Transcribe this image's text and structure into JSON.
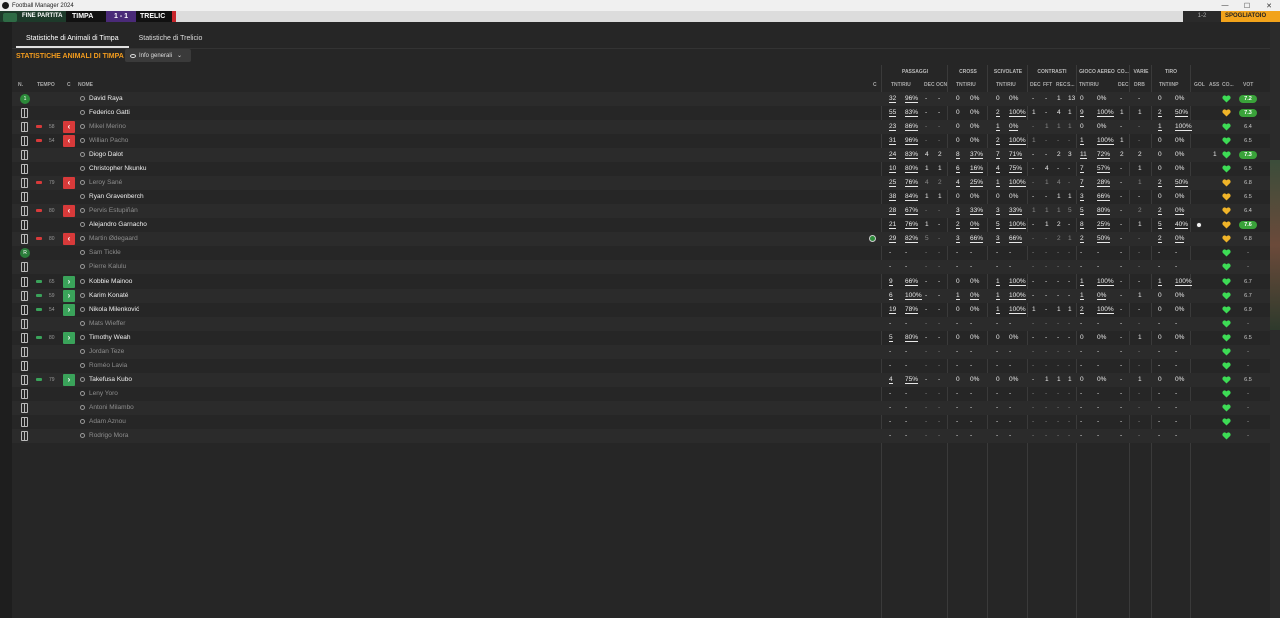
{
  "window": {
    "title": "Football Manager 2024",
    "min": "—",
    "max": "☐",
    "close": "✕"
  },
  "match": {
    "status": "FINE PARTITA",
    "home": "TIMPA",
    "score": "1 - 1",
    "away": "TRELIC",
    "right_score": "1-2",
    "right_btn": "SPOGLIATOIO"
  },
  "tabs": [
    {
      "label": "Statistiche di Animali di Timpa"
    },
    {
      "label": "Statistiche di Trelicio"
    }
  ],
  "section_title": "STATISTICHE ANIMALI DI TIMPA",
  "view_select": {
    "label": "Info generali"
  },
  "groups": {
    "passaggi": "PASSAGGI",
    "cross": "CROSS",
    "scivolate": "SCIVOLATE",
    "contrasti": "CONTRASTI",
    "aereo": "GIOCO AEREO",
    "co": "CO...",
    "varie": "VARIE",
    "tiro": "TIRO"
  },
  "columns": {
    "n": "N.",
    "tempo": "TEMPO",
    "c": "C",
    "nome": "NOME",
    "c2": "C",
    "pass_tnt": "TNT/RIU",
    "dec": "DEC",
    "occ": "OCN",
    "cross_tnt": "TNT/RIU",
    "sciv_tnt": "TNT/RIU",
    "cont_dec": "DEC",
    "cont_fft": "FFT",
    "cont_rec": "REC",
    "cont_s": "S...",
    "aereo_tnt": "TNT/RIU",
    "co_dec": "DEC",
    "drb": "DRB",
    "tiro_tnt": "TNT/INP",
    "gol": "GOL",
    "ass": "ASS",
    "cond": "CO...",
    "vot": "VOT"
  },
  "players": [
    {
      "badge": "1",
      "min": "",
      "sub": "",
      "name": "David Raya",
      "bench": false,
      "pass": [
        "32",
        "96%"
      ],
      "dec": "-",
      "ocn": "-",
      "cross": [
        "0",
        "0%"
      ],
      "sciv": [
        "0",
        "0%"
      ],
      "cont": [
        "-",
        "-",
        "1",
        "13"
      ],
      "aereo": [
        "0",
        "0%"
      ],
      "codec": "-",
      "drb": "-",
      "tiro": [
        "0",
        "0%"
      ],
      "gol": "",
      "ass": "",
      "heart": "green",
      "vot": "7.2",
      "vcolor": "#3aa33a"
    },
    {
      "badge": "",
      "min": "",
      "sub": "",
      "name": "Federico Gatti",
      "bench": false,
      "pass": [
        "55",
        "83%"
      ],
      "dec": "-",
      "ocn": "-",
      "cross": [
        "0",
        "0%"
      ],
      "sciv": [
        "2",
        "100%"
      ],
      "cont": [
        "1",
        "-",
        "4",
        "1"
      ],
      "aereo": [
        "9",
        "100%"
      ],
      "codec": "1",
      "drb": "1",
      "tiro": [
        "2",
        "50%"
      ],
      "gol": "",
      "ass": "",
      "heart": "gold",
      "vot": "7.3",
      "vcolor": "#3aa33a"
    },
    {
      "badge": "",
      "min": "58",
      "sub": "out",
      "name": "Mikel Merino",
      "bench": true,
      "pass": [
        "23",
        "86%"
      ],
      "dec": "-",
      "ocn": "-",
      "cross": [
        "0",
        "0%"
      ],
      "sciv": [
        "1",
        "0%"
      ],
      "cont": [
        "-",
        "1",
        "1",
        "1"
      ],
      "aereo": [
        "0",
        "0%"
      ],
      "codec": "-",
      "drb": "-",
      "tiro": [
        "1",
        "100%"
      ],
      "gol": "",
      "ass": "",
      "heart": "green",
      "vot": "6.4",
      "vcolor": ""
    },
    {
      "badge": "",
      "min": "54",
      "sub": "out",
      "name": "Willian Pacho",
      "bench": true,
      "pass": [
        "31",
        "96%"
      ],
      "dec": "-",
      "ocn": "-",
      "cross": [
        "0",
        "0%"
      ],
      "sciv": [
        "2",
        "100%"
      ],
      "cont": [
        "1",
        "-",
        "-",
        "-"
      ],
      "aereo": [
        "1",
        "100%"
      ],
      "codec": "1",
      "drb": "-",
      "tiro": [
        "0",
        "0%"
      ],
      "gol": "",
      "ass": "",
      "heart": "green",
      "vot": "6.5",
      "vcolor": ""
    },
    {
      "badge": "",
      "min": "",
      "sub": "",
      "name": "Diogo Dalot",
      "bench": false,
      "pass": [
        "24",
        "83%"
      ],
      "dec": "4",
      "ocn": "2",
      "cross": [
        "8",
        "37%"
      ],
      "sciv": [
        "7",
        "71%"
      ],
      "cont": [
        "-",
        "-",
        "2",
        "3"
      ],
      "aereo": [
        "11",
        "72%"
      ],
      "codec": "2",
      "drb": "2",
      "tiro": [
        "0",
        "0%"
      ],
      "gol": "",
      "ass": "1",
      "heart": "green",
      "vot": "7.3",
      "vcolor": "#3aa33a"
    },
    {
      "badge": "",
      "min": "",
      "sub": "",
      "name": "Christopher Nkunku",
      "bench": false,
      "pass": [
        "10",
        "80%"
      ],
      "dec": "1",
      "ocn": "1",
      "cross": [
        "6",
        "16%"
      ],
      "sciv": [
        "4",
        "75%"
      ],
      "cont": [
        "-",
        "4",
        "-",
        "-"
      ],
      "aereo": [
        "7",
        "57%"
      ],
      "codec": "-",
      "drb": "1",
      "tiro": [
        "0",
        "0%"
      ],
      "gol": "",
      "ass": "",
      "heart": "green",
      "vot": "6.5",
      "vcolor": ""
    },
    {
      "badge": "",
      "min": "79",
      "sub": "out",
      "name": "Leroy Sané",
      "bench": true,
      "pass": [
        "25",
        "76%"
      ],
      "dec": "4",
      "ocn": "2",
      "cross": [
        "4",
        "25%"
      ],
      "sciv": [
        "1",
        "100%"
      ],
      "cont": [
        "-",
        "1",
        "4",
        "-"
      ],
      "aereo": [
        "7",
        "28%"
      ],
      "codec": "-",
      "drb": "1",
      "tiro": [
        "2",
        "50%"
      ],
      "gol": "",
      "ass": "",
      "heart": "gold",
      "vot": "6.8",
      "vcolor": ""
    },
    {
      "badge": "",
      "min": "",
      "sub": "",
      "name": "Ryan Gravenberch",
      "bench": false,
      "pass": [
        "38",
        "84%"
      ],
      "dec": "1",
      "ocn": "1",
      "cross": [
        "0",
        "0%"
      ],
      "sciv": [
        "0",
        "0%"
      ],
      "cont": [
        "-",
        "-",
        "1",
        "1"
      ],
      "aereo": [
        "3",
        "66%"
      ],
      "codec": "-",
      "drb": "-",
      "tiro": [
        "0",
        "0%"
      ],
      "gol": "",
      "ass": "",
      "heart": "gold",
      "vot": "6.5",
      "vcolor": ""
    },
    {
      "badge": "",
      "min": "80",
      "sub": "out",
      "name": "Pervis Estupiñán",
      "bench": true,
      "pass": [
        "28",
        "67%"
      ],
      "dec": "-",
      "ocn": "-",
      "cross": [
        "3",
        "33%"
      ],
      "sciv": [
        "3",
        "33%"
      ],
      "cont": [
        "1",
        "1",
        "1",
        "5"
      ],
      "aereo": [
        "5",
        "80%"
      ],
      "codec": "-",
      "drb": "2",
      "tiro": [
        "2",
        "0%"
      ],
      "gol": "",
      "ass": "",
      "heart": "gold",
      "vot": "6.4",
      "vcolor": ""
    },
    {
      "badge": "",
      "min": "",
      "sub": "",
      "name": "Alejandro Garnacho",
      "bench": false,
      "pass": [
        "21",
        "76%"
      ],
      "dec": "1",
      "ocn": "-",
      "cross": [
        "2",
        "0%"
      ],
      "sciv": [
        "5",
        "100%"
      ],
      "cont": [
        "-",
        "1",
        "2",
        "-"
      ],
      "aereo": [
        "8",
        "25%"
      ],
      "codec": "-",
      "drb": "1",
      "tiro": [
        "5",
        "40%"
      ],
      "gol": "ball",
      "ass": "",
      "heart": "gold",
      "vot": "7.6",
      "vcolor": "#3aa33a"
    },
    {
      "badge": "",
      "min": "80",
      "sub": "out",
      "name": "Martin Ødegaard",
      "bench": true,
      "pass": [
        "29",
        "82%"
      ],
      "dec": "5",
      "ocn": "-",
      "cross": [
        "3",
        "66%"
      ],
      "sciv": [
        "3",
        "66%"
      ],
      "cont": [
        "-",
        "-",
        "2",
        "1"
      ],
      "aereo": [
        "2",
        "50%"
      ],
      "codec": "-",
      "drb": "-",
      "tiro": [
        "2",
        "0%"
      ],
      "gol": "",
      "ass": "",
      "heart": "gold",
      "vot": "6.8",
      "vcolor": "",
      "pen": true
    },
    {
      "badge": "R",
      "min": "",
      "sub": "",
      "name": "Sam Tickle",
      "bench": true,
      "pass": [
        "-",
        "-"
      ],
      "dec": "-",
      "ocn": "-",
      "cross": [
        "-",
        "-"
      ],
      "sciv": [
        "-",
        "-"
      ],
      "cont": [
        "-",
        "-",
        "-",
        "-"
      ],
      "aereo": [
        "-",
        "-"
      ],
      "codec": "-",
      "drb": "-",
      "tiro": [
        "-",
        "-"
      ],
      "gol": "",
      "ass": "",
      "heart": "green",
      "vot": "-",
      "vcolor": ""
    },
    {
      "badge": "",
      "min": "",
      "sub": "",
      "name": "Pierre Kalulu",
      "bench": true,
      "pass": [
        "-",
        "-"
      ],
      "dec": "-",
      "ocn": "-",
      "cross": [
        "-",
        "-"
      ],
      "sciv": [
        "-",
        "-"
      ],
      "cont": [
        "-",
        "-",
        "-",
        "-"
      ],
      "aereo": [
        "-",
        "-"
      ],
      "codec": "-",
      "drb": "-",
      "tiro": [
        "-",
        "-"
      ],
      "gol": "",
      "ass": "",
      "heart": "green",
      "vot": "-",
      "vcolor": ""
    },
    {
      "badge": "",
      "min": "65",
      "sub": "in",
      "name": "Kobbie Mainoo",
      "bench": false,
      "pass": [
        "9",
        "66%"
      ],
      "dec": "-",
      "ocn": "-",
      "cross": [
        "0",
        "0%"
      ],
      "sciv": [
        "1",
        "100%"
      ],
      "cont": [
        "-",
        "-",
        "-",
        "-"
      ],
      "aereo": [
        "1",
        "100%"
      ],
      "codec": "-",
      "drb": "-",
      "tiro": [
        "1",
        "100%"
      ],
      "gol": "",
      "ass": "",
      "heart": "green",
      "vot": "6.7",
      "vcolor": ""
    },
    {
      "badge": "",
      "min": "59",
      "sub": "in",
      "name": "Karim Konaté",
      "bench": false,
      "pass": [
        "6",
        "100%"
      ],
      "dec": "-",
      "ocn": "-",
      "cross": [
        "1",
        "0%"
      ],
      "sciv": [
        "1",
        "100%"
      ],
      "cont": [
        "-",
        "-",
        "-",
        "-"
      ],
      "aereo": [
        "1",
        "0%"
      ],
      "codec": "-",
      "drb": "1",
      "tiro": [
        "0",
        "0%"
      ],
      "gol": "",
      "ass": "",
      "heart": "green",
      "vot": "6.7",
      "vcolor": ""
    },
    {
      "badge": "",
      "min": "54",
      "sub": "in",
      "name": "Nikola Milenković",
      "bench": false,
      "pass": [
        "19",
        "78%"
      ],
      "dec": "-",
      "ocn": "-",
      "cross": [
        "0",
        "0%"
      ],
      "sciv": [
        "1",
        "100%"
      ],
      "cont": [
        "1",
        "-",
        "1",
        "1"
      ],
      "aereo": [
        "2",
        "100%"
      ],
      "codec": "-",
      "drb": "-",
      "tiro": [
        "0",
        "0%"
      ],
      "gol": "",
      "ass": "",
      "heart": "green",
      "vot": "6.9",
      "vcolor": ""
    },
    {
      "badge": "",
      "min": "",
      "sub": "",
      "name": "Mats Wieffer",
      "bench": true,
      "pass": [
        "-",
        "-"
      ],
      "dec": "-",
      "ocn": "-",
      "cross": [
        "-",
        "-"
      ],
      "sciv": [
        "-",
        "-"
      ],
      "cont": [
        "-",
        "-",
        "-",
        "-"
      ],
      "aereo": [
        "-",
        "-"
      ],
      "codec": "-",
      "drb": "-",
      "tiro": [
        "-",
        "-"
      ],
      "gol": "",
      "ass": "",
      "heart": "green",
      "vot": "-",
      "vcolor": ""
    },
    {
      "badge": "",
      "min": "80",
      "sub": "in",
      "name": "Timothy Weah",
      "bench": false,
      "pass": [
        "5",
        "80%"
      ],
      "dec": "-",
      "ocn": "-",
      "cross": [
        "0",
        "0%"
      ],
      "sciv": [
        "0",
        "0%"
      ],
      "cont": [
        "-",
        "-",
        "-",
        "-"
      ],
      "aereo": [
        "0",
        "0%"
      ],
      "codec": "-",
      "drb": "1",
      "tiro": [
        "0",
        "0%"
      ],
      "gol": "",
      "ass": "",
      "heart": "green",
      "vot": "6.5",
      "vcolor": ""
    },
    {
      "badge": "",
      "min": "",
      "sub": "",
      "name": "Jordan Teze",
      "bench": true,
      "pass": [
        "-",
        "-"
      ],
      "dec": "-",
      "ocn": "-",
      "cross": [
        "-",
        "-"
      ],
      "sciv": [
        "-",
        "-"
      ],
      "cont": [
        "-",
        "-",
        "-",
        "-"
      ],
      "aereo": [
        "-",
        "-"
      ],
      "codec": "-",
      "drb": "-",
      "tiro": [
        "-",
        "-"
      ],
      "gol": "",
      "ass": "",
      "heart": "green",
      "vot": "-",
      "vcolor": ""
    },
    {
      "badge": "",
      "min": "",
      "sub": "",
      "name": "Roméo Lavia",
      "bench": true,
      "pass": [
        "-",
        "-"
      ],
      "dec": "-",
      "ocn": "-",
      "cross": [
        "-",
        "-"
      ],
      "sciv": [
        "-",
        "-"
      ],
      "cont": [
        "-",
        "-",
        "-",
        "-"
      ],
      "aereo": [
        "-",
        "-"
      ],
      "codec": "-",
      "drb": "-",
      "tiro": [
        "-",
        "-"
      ],
      "gol": "",
      "ass": "",
      "heart": "green",
      "vot": "-",
      "vcolor": ""
    },
    {
      "badge": "",
      "min": "79",
      "sub": "in",
      "name": "Takefusa Kubo",
      "bench": false,
      "pass": [
        "4",
        "75%"
      ],
      "dec": "-",
      "ocn": "-",
      "cross": [
        "0",
        "0%"
      ],
      "sciv": [
        "0",
        "0%"
      ],
      "cont": [
        "-",
        "1",
        "1",
        "1"
      ],
      "aereo": [
        "0",
        "0%"
      ],
      "codec": "-",
      "drb": "1",
      "tiro": [
        "0",
        "0%"
      ],
      "gol": "",
      "ass": "",
      "heart": "green",
      "vot": "6.5",
      "vcolor": ""
    },
    {
      "badge": "",
      "min": "",
      "sub": "",
      "name": "Leny Yoro",
      "bench": true,
      "pass": [
        "-",
        "-"
      ],
      "dec": "-",
      "ocn": "-",
      "cross": [
        "-",
        "-"
      ],
      "sciv": [
        "-",
        "-"
      ],
      "cont": [
        "-",
        "-",
        "-",
        "-"
      ],
      "aereo": [
        "-",
        "-"
      ],
      "codec": "-",
      "drb": "-",
      "tiro": [
        "-",
        "-"
      ],
      "gol": "",
      "ass": "",
      "heart": "green",
      "vot": "-",
      "vcolor": ""
    },
    {
      "badge": "",
      "min": "",
      "sub": "",
      "name": "Antoni Milambo",
      "bench": true,
      "pass": [
        "-",
        "-"
      ],
      "dec": "-",
      "ocn": "-",
      "cross": [
        "-",
        "-"
      ],
      "sciv": [
        "-",
        "-"
      ],
      "cont": [
        "-",
        "-",
        "-",
        "-"
      ],
      "aereo": [
        "-",
        "-"
      ],
      "codec": "-",
      "drb": "-",
      "tiro": [
        "-",
        "-"
      ],
      "gol": "",
      "ass": "",
      "heart": "green",
      "vot": "-",
      "vcolor": ""
    },
    {
      "badge": "",
      "min": "",
      "sub": "",
      "name": "Adam Aznou",
      "bench": true,
      "pass": [
        "-",
        "-"
      ],
      "dec": "-",
      "ocn": "-",
      "cross": [
        "-",
        "-"
      ],
      "sciv": [
        "-",
        "-"
      ],
      "cont": [
        "-",
        "-",
        "-",
        "-"
      ],
      "aereo": [
        "-",
        "-"
      ],
      "codec": "-",
      "drb": "-",
      "tiro": [
        "-",
        "-"
      ],
      "gol": "",
      "ass": "",
      "heart": "green",
      "vot": "-",
      "vcolor": ""
    },
    {
      "badge": "",
      "min": "",
      "sub": "",
      "name": "Rodrigo Mora",
      "bench": true,
      "pass": [
        "-",
        "-"
      ],
      "dec": "-",
      "ocn": "-",
      "cross": [
        "-",
        "-"
      ],
      "sciv": [
        "-",
        "-"
      ],
      "cont": [
        "-",
        "-",
        "-",
        "-"
      ],
      "aereo": [
        "-",
        "-"
      ],
      "codec": "-",
      "drb": "-",
      "tiro": [
        "-",
        "-"
      ],
      "gol": "",
      "ass": "",
      "heart": "green",
      "vot": "-",
      "vcolor": ""
    }
  ],
  "colors": {
    "accent": "#f39c1e",
    "sub_out": "#d83a3a",
    "sub_in": "#3aa35a",
    "heart_green": "#3ddc55",
    "heart_gold": "#f0b429"
  }
}
